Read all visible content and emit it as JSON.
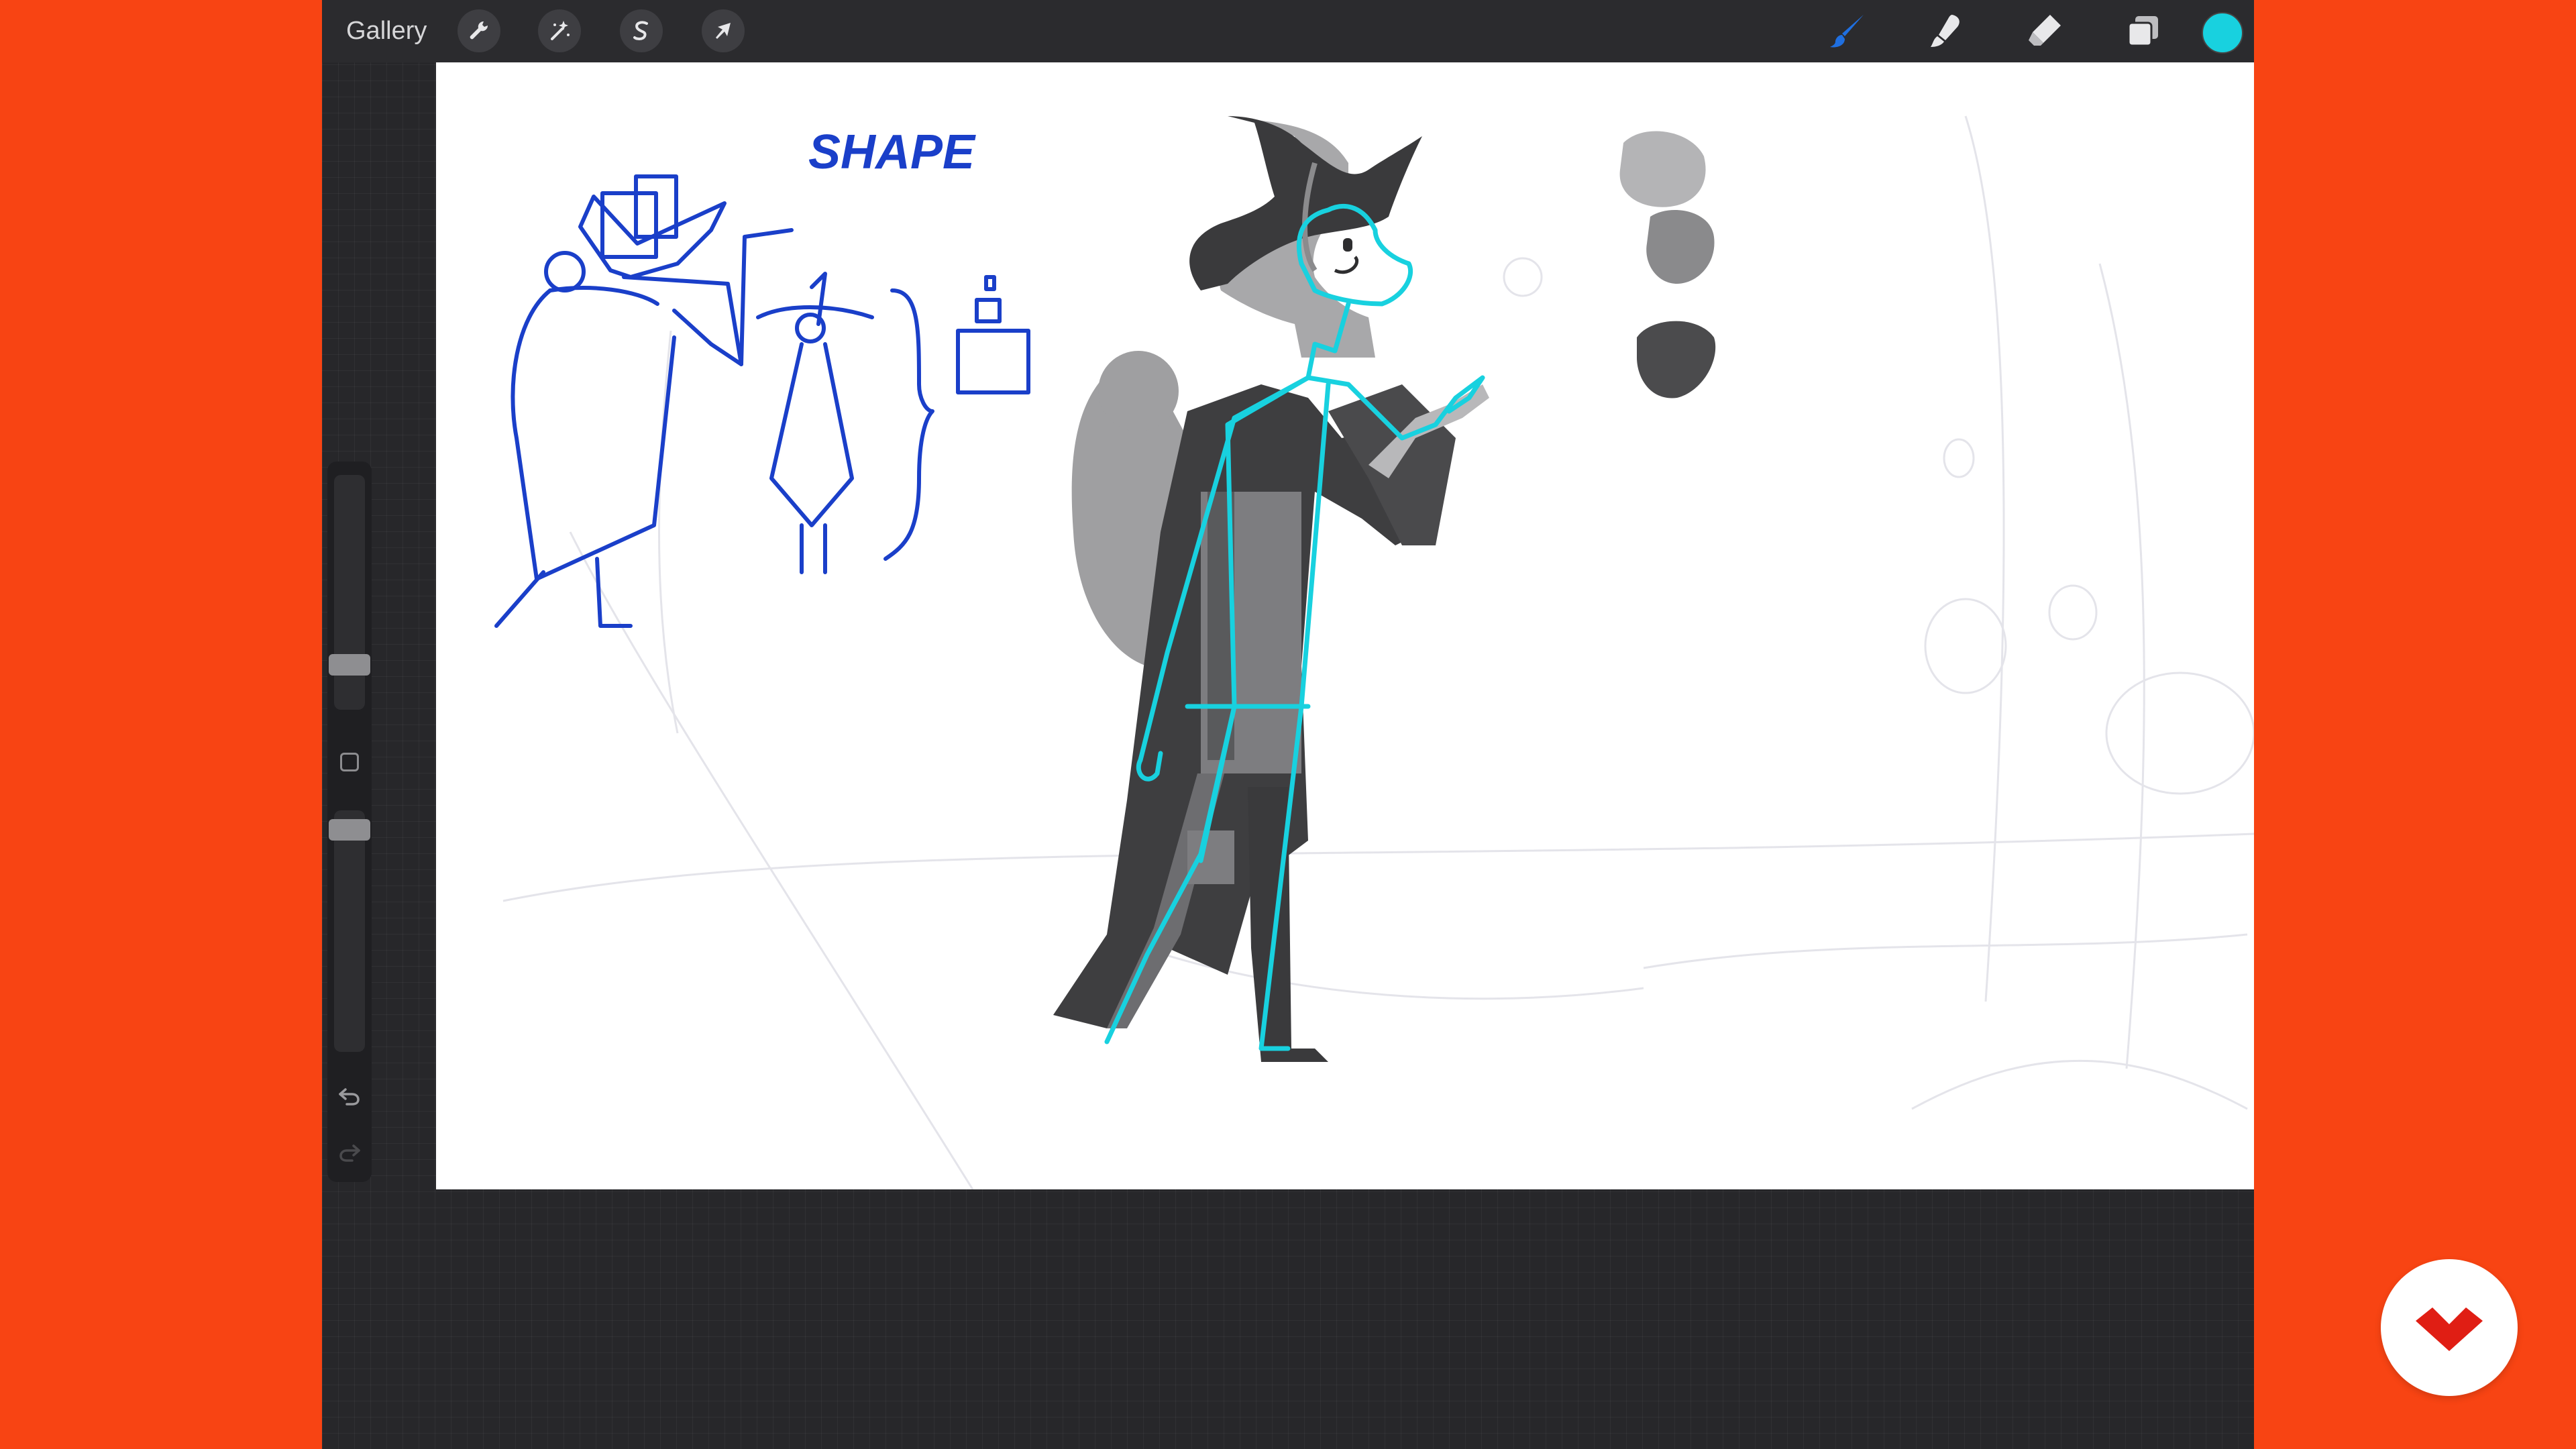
{
  "toolbar": {
    "gallery_label": "Gallery",
    "left_tools": [
      {
        "name": "actions",
        "icon": "wrench-icon"
      },
      {
        "name": "adjustments",
        "icon": "magic-wand-icon"
      },
      {
        "name": "selection",
        "icon": "selection-s-icon"
      },
      {
        "name": "transform",
        "icon": "arrow-cursor-icon"
      }
    ],
    "right_tools": [
      {
        "name": "brush",
        "icon": "brush-icon",
        "active": true
      },
      {
        "name": "smudge",
        "icon": "smudge-icon"
      },
      {
        "name": "eraser",
        "icon": "eraser-icon"
      },
      {
        "name": "layers",
        "icon": "layers-icon"
      }
    ],
    "current_color": "#18d1df",
    "active_tool_color": "#1f6fe0"
  },
  "sidebar": {
    "brush_size_level": 0.16,
    "opacity_level": 0.96,
    "undo_icon": "undo-icon",
    "redo_icon": "redo-icon"
  },
  "canvas": {
    "sketch_label": "SHAPE",
    "sketch_color": "#1a3fc9",
    "skeleton_color": "#18d1df",
    "value_swatches": [
      "#b4b4b6",
      "#8a8a8c",
      "#4b4b4d"
    ]
  },
  "brand": {
    "logo_icon": "brand-logo-icon",
    "logo_color": "#e01e14"
  }
}
